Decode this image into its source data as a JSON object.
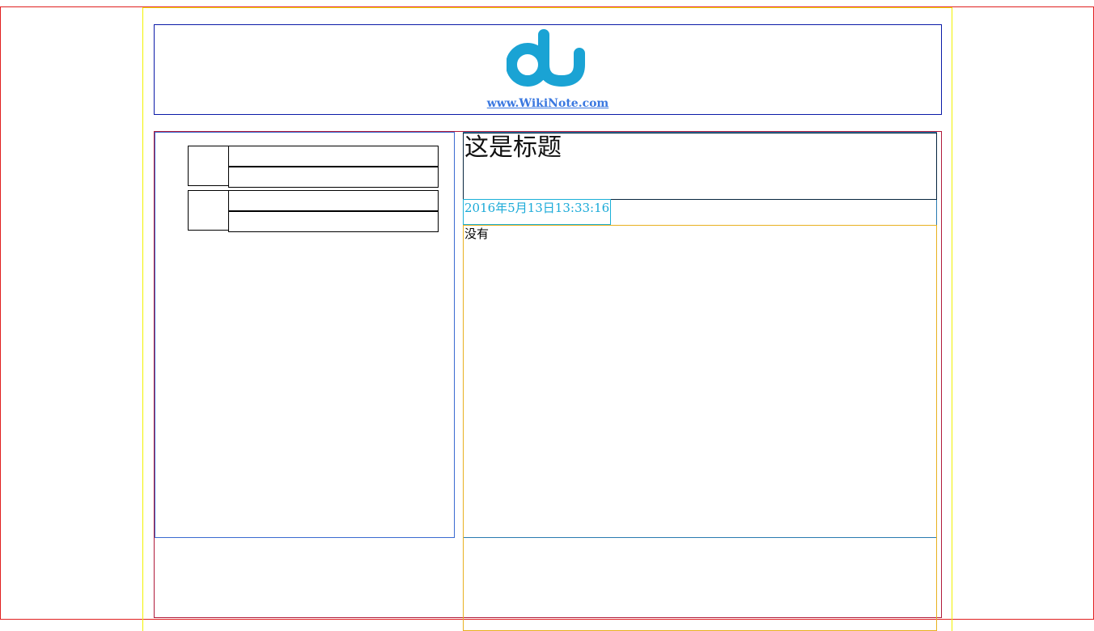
{
  "header": {
    "logo_icon": "du-logo",
    "logo_color": "#1aa3d4",
    "site_link": "www.WikiNote.com"
  },
  "sidebar": {
    "items": [
      {
        "thumb": "",
        "line1": "",
        "line2": ""
      },
      {
        "thumb": "",
        "line1": "",
        "line2": ""
      }
    ]
  },
  "article": {
    "title": "这是标题",
    "date": "2016年5月13日13:33:16",
    "content": "没有"
  }
}
